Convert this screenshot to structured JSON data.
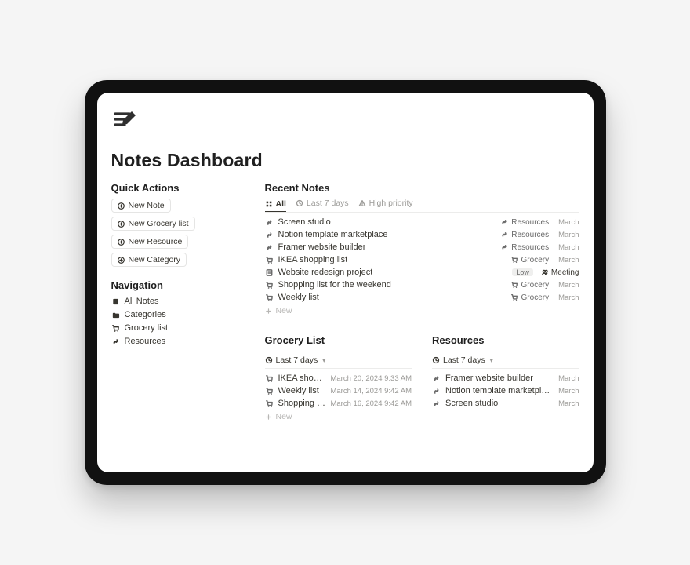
{
  "page": {
    "title": "Notes Dashboard"
  },
  "quick_actions": {
    "heading": "Quick Actions",
    "items": [
      {
        "label": "New Note"
      },
      {
        "label": "New Grocery list"
      },
      {
        "label": "New Resource"
      },
      {
        "label": "New Category"
      }
    ]
  },
  "navigation": {
    "heading": "Navigation",
    "items": [
      {
        "icon": "notes",
        "label": "All Notes"
      },
      {
        "icon": "folder",
        "label": "Categories"
      },
      {
        "icon": "cart",
        "label": "Grocery list"
      },
      {
        "icon": "link",
        "label": "Resources"
      }
    ]
  },
  "recent": {
    "heading": "Recent Notes",
    "tabs": [
      {
        "icon": "grid",
        "label": "All",
        "active": true
      },
      {
        "icon": "clock",
        "label": "Last 7 days"
      },
      {
        "icon": "warn",
        "label": "High priority"
      }
    ],
    "rows": [
      {
        "icon": "link",
        "title": "Screen studio",
        "category_icon": "link",
        "category": "Resources",
        "date": "March"
      },
      {
        "icon": "link",
        "title": "Notion template marketplace",
        "category_icon": "link",
        "category": "Resources",
        "date": "March"
      },
      {
        "icon": "link",
        "title": "Framer website builder",
        "category_icon": "link",
        "category": "Resources",
        "date": "March"
      },
      {
        "icon": "cart",
        "title": "IKEA shopping list",
        "category_icon": "cart",
        "category": "Grocery",
        "date": "March"
      },
      {
        "icon": "note",
        "title": "Website redesign project",
        "badge": "Low",
        "meeting_icon": "people",
        "meeting": "Meeting"
      },
      {
        "icon": "cart",
        "title": "Shopping list for the weekend",
        "category_icon": "cart",
        "category": "Grocery",
        "date": "March"
      },
      {
        "icon": "cart",
        "title": "Weekly list",
        "category_icon": "cart",
        "category": "Grocery",
        "date": "March"
      }
    ],
    "new_label": "New"
  },
  "grocery": {
    "heading": "Grocery List",
    "view": "Last 7 days",
    "rows": [
      {
        "title": "IKEA shopping list",
        "date": "March 20, 2024 9:33 AM"
      },
      {
        "title": "Weekly list",
        "date": "March 14, 2024 9:42 AM"
      },
      {
        "title": "Shopping list for the weekend",
        "date": "March 16, 2024 9:42 AM"
      }
    ],
    "new_label": "New"
  },
  "resources": {
    "heading": "Resources",
    "view": "Last 7 days",
    "rows": [
      {
        "title": "Framer website builder",
        "date": "March"
      },
      {
        "title": "Notion template marketplace",
        "date": "March"
      },
      {
        "title": "Screen studio",
        "date": "March"
      }
    ]
  }
}
